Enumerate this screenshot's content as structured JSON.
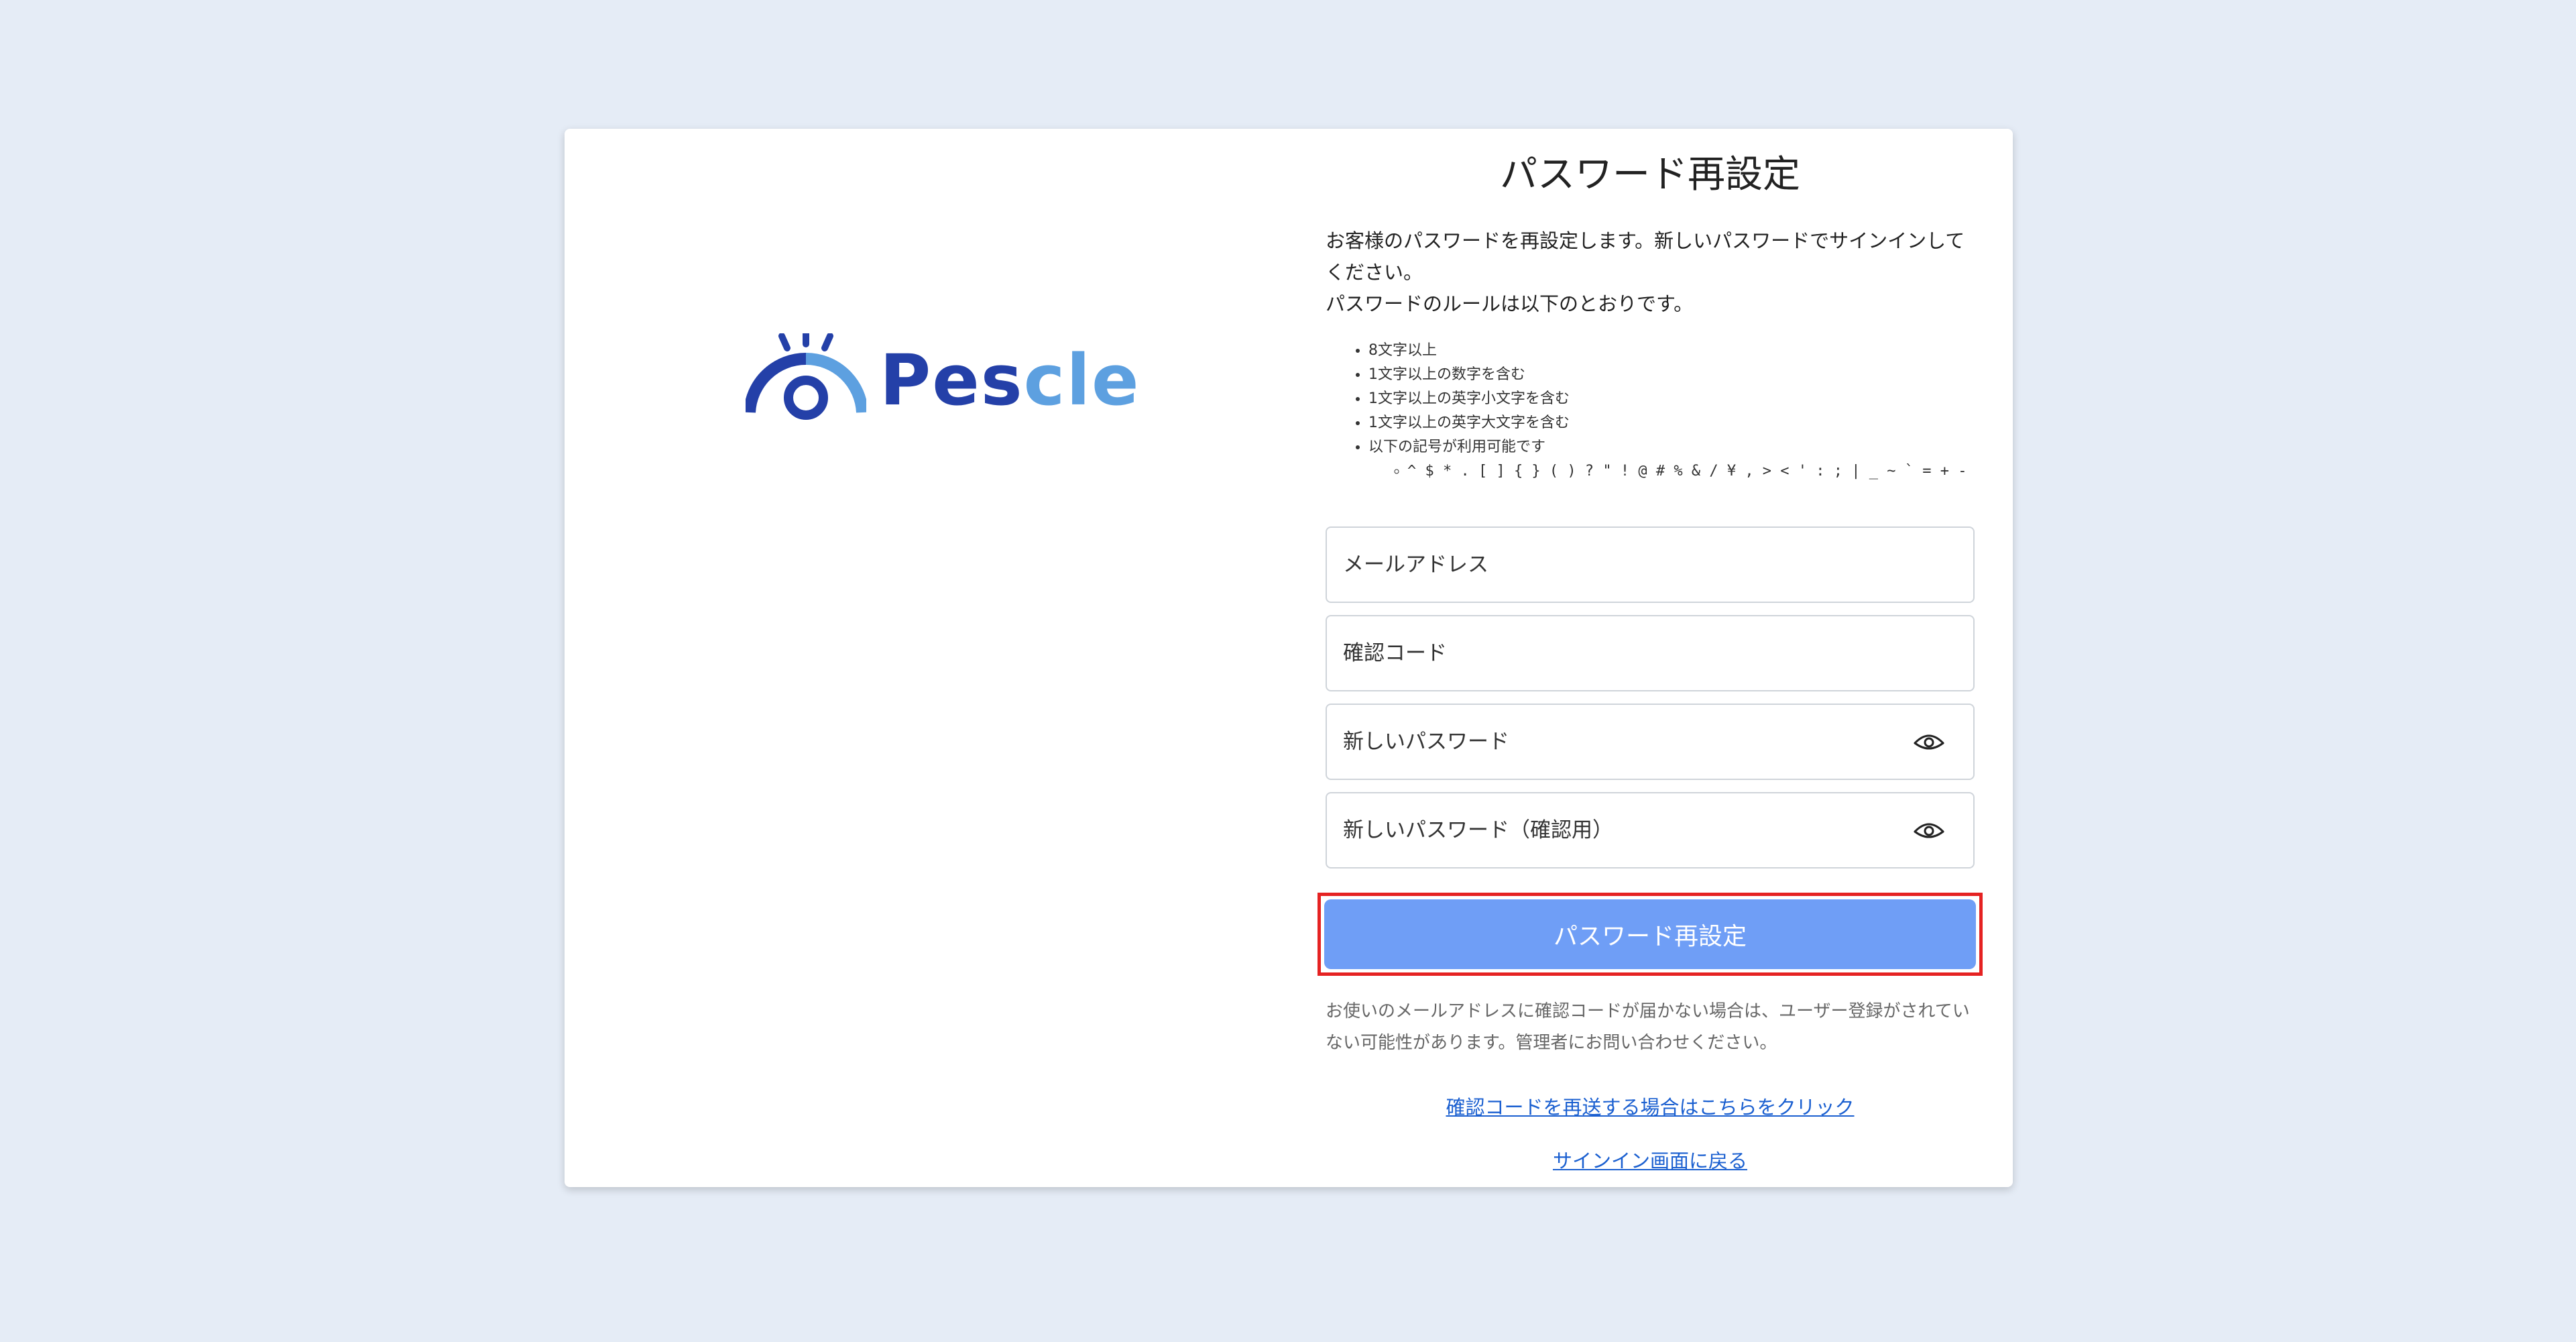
{
  "logo": {
    "name_part1": "Pes",
    "name_part2": "cle",
    "colors": {
      "dark": "#2440a8",
      "light": "#5da0e0"
    }
  },
  "form": {
    "title": "パスワード再設定",
    "description_line1": "お客様のパスワードを再設定します。新しいパスワードでサインインしてください。",
    "description_line2": "パスワードのルールは以下のとおりです。",
    "rules": [
      "8文字以上",
      "1文字以上の数字を含む",
      "1文字以上の英字小文字を含む",
      "1文字以上の英字大文字を含む",
      "以下の記号が利用可能です"
    ],
    "symbols": "^ $ * . [ ] { } ( ) ? \" ! @ # % & / ¥ , > < ' : ; | _ ~ ` = + -",
    "fields": {
      "email_placeholder": "メールアドレス",
      "code_placeholder": "確認コード",
      "new_password_placeholder": "新しいパスワード",
      "confirm_password_placeholder": "新しいパスワード（確認用）"
    },
    "submit_label": "パスワード再設定",
    "note": "お使いのメールアドレスに確認コードが届かない場合は、ユーザー登録がされていない可能性があります。管理者にお問い合わせください。",
    "links": {
      "resend_code": "確認コードを再送する場合はこちらをクリック",
      "back_to_signin": "サインイン画面に戻る"
    }
  },
  "colors": {
    "background": "#e5ecf6",
    "button": "#6f9ef6",
    "link": "#1a5fd0",
    "highlight": "#e52222"
  }
}
